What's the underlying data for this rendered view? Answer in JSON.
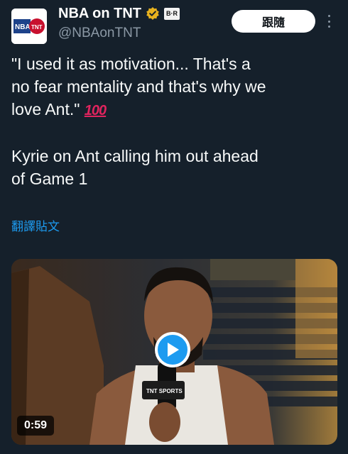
{
  "header": {
    "display_name": "NBA on TNT",
    "handle": "@NBAonTNT",
    "br_badge": "B·R",
    "follow_label": "跟隨",
    "avatar_logo_text": "NBA",
    "avatar_tnt_text": "TNT"
  },
  "tweet": {
    "line1": "\"I used it as motivation... That's a",
    "line2": "no fear mentality and that's why we",
    "line3": "love Ant.\" ",
    "emoji": "100",
    "line5": "Kyrie on Ant calling him out ahead",
    "line6": "of Game 1",
    "translate_label": "翻譯貼文"
  },
  "media": {
    "duration": "0:59",
    "mic_flag_text": "TNT SPORTS"
  },
  "colors": {
    "background": "#15202b",
    "accent": "#1d9bf0",
    "secondary_text": "#8b98a5",
    "verified_gold": "#e8b21e"
  },
  "icons": {
    "verified": "verified-badge-icon",
    "more": "more-dots-icon",
    "play": "play-icon"
  }
}
